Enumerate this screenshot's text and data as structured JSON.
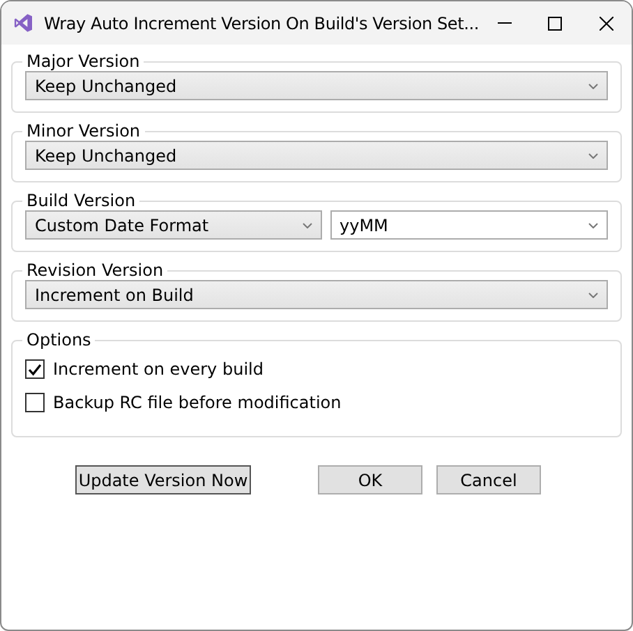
{
  "window": {
    "title": "Wray Auto Increment Version On Build's Version Set..."
  },
  "groups": [
    {
      "title": "Major Version",
      "combos": [
        {
          "kind": "dropdown",
          "value": "Keep Unchanged"
        }
      ]
    },
    {
      "title": "Minor Version",
      "combos": [
        {
          "kind": "dropdown",
          "value": "Keep Unchanged"
        }
      ]
    },
    {
      "title": "Build Version",
      "combos": [
        {
          "kind": "dropdown",
          "value": "Custom Date Format"
        },
        {
          "kind": "editable",
          "value": "yyMM"
        }
      ]
    },
    {
      "title": "Revision Version",
      "combos": [
        {
          "kind": "dropdown",
          "value": "Increment on Build"
        }
      ]
    }
  ],
  "options": {
    "title": "Options",
    "checkboxes": [
      {
        "label": "Increment on every build",
        "checked": true
      },
      {
        "label": "Backup RC file before modification",
        "checked": false
      }
    ]
  },
  "buttons": [
    {
      "label": "Update Version Now",
      "focused": true
    },
    {
      "label": "OK",
      "focused": false
    },
    {
      "label": "Cancel",
      "focused": false
    }
  ]
}
